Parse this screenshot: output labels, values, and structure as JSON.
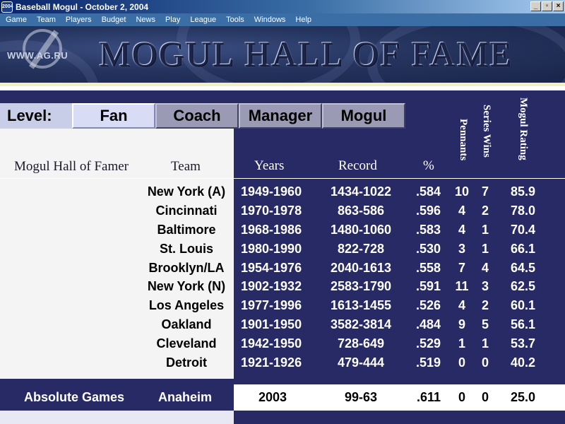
{
  "window": {
    "title": "Baseball Mogul - October 2, 2004",
    "app_icon_text": "2004",
    "buttons": [
      "_",
      "▫",
      "×"
    ]
  },
  "menu": [
    "Game",
    "Team",
    "Players",
    "Budget",
    "News",
    "Play",
    "League",
    "Tools",
    "Windows",
    "Help"
  ],
  "banner": {
    "title": "MOGUL HALL OF FAME",
    "watermark": "WWW.AG.RU"
  },
  "level": {
    "label": "Level:",
    "options": [
      "Fan",
      "Coach",
      "Manager",
      "Mogul"
    ],
    "selected": "Fan"
  },
  "columns": {
    "name": "Mogul Hall of Famer",
    "team": "Team",
    "years": "Years",
    "record": "Record",
    "pct": "%",
    "pennants": "Pennants",
    "series_wins": "Series Wins",
    "rating": "Mogul Rating"
  },
  "rows": [
    {
      "name": "",
      "team": "New York (A)",
      "years": "1949-1960",
      "record": "1434-1022",
      "pct": ".584",
      "pennants": "10",
      "series_wins": "7",
      "rating": "85.9"
    },
    {
      "name": "",
      "team": "Cincinnati",
      "years": "1970-1978",
      "record": "863-586",
      "pct": ".596",
      "pennants": "4",
      "series_wins": "2",
      "rating": "78.0"
    },
    {
      "name": "",
      "team": "Baltimore",
      "years": "1968-1986",
      "record": "1480-1060",
      "pct": ".583",
      "pennants": "4",
      "series_wins": "1",
      "rating": "70.4"
    },
    {
      "name": "",
      "team": "St. Louis",
      "years": "1980-1990",
      "record": "822-728",
      "pct": ".530",
      "pennants": "3",
      "series_wins": "1",
      "rating": "66.1"
    },
    {
      "name": "",
      "team": "Brooklyn/LA",
      "years": "1954-1976",
      "record": "2040-1613",
      "pct": ".558",
      "pennants": "7",
      "series_wins": "4",
      "rating": "64.5"
    },
    {
      "name": "",
      "team": "New York (N)",
      "years": "1902-1932",
      "record": "2583-1790",
      "pct": ".591",
      "pennants": "11",
      "series_wins": "3",
      "rating": "62.5"
    },
    {
      "name": "",
      "team": "Los Angeles",
      "years": "1977-1996",
      "record": "1613-1455",
      "pct": ".526",
      "pennants": "4",
      "series_wins": "2",
      "rating": "60.1"
    },
    {
      "name": "",
      "team": "Oakland",
      "years": "1901-1950",
      "record": "3582-3814",
      "pct": ".484",
      "pennants": "9",
      "series_wins": "5",
      "rating": "56.1"
    },
    {
      "name": "",
      "team": "Cleveland",
      "years": "1942-1950",
      "record": "728-649",
      "pct": ".529",
      "pennants": "1",
      "series_wins": "1",
      "rating": "53.7"
    },
    {
      "name": "",
      "team": "Detroit",
      "years": "1921-1926",
      "record": "479-444",
      "pct": ".519",
      "pennants": "0",
      "series_wins": "0",
      "rating": "40.2"
    }
  ],
  "current": {
    "name": "Absolute Games",
    "team": "Anaheim",
    "years": "2003",
    "record": "99-63",
    "pct": ".611",
    "pennants": "0",
    "series_wins": "0",
    "rating": "25.0"
  }
}
